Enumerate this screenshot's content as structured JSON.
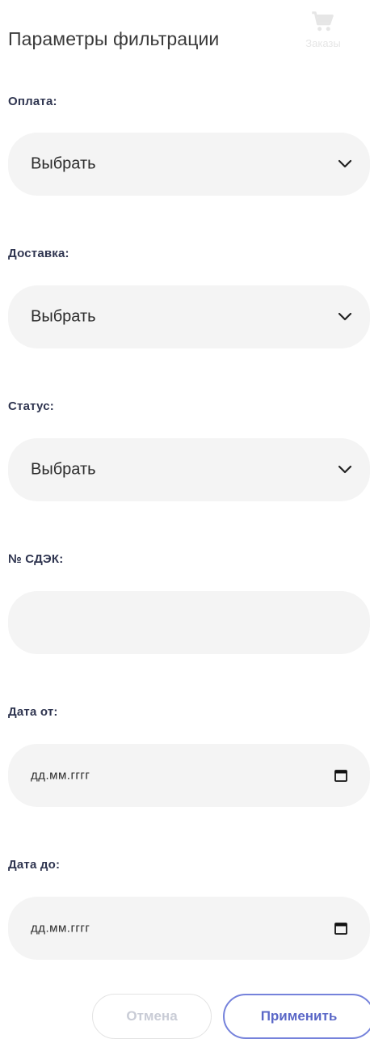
{
  "header": {
    "title": "Параметры фильтрации",
    "cart_label": "Заказы",
    "cart_icon": "shopping-cart-icon"
  },
  "fields": {
    "payment": {
      "label": "Оплата:",
      "value": "Выбрать"
    },
    "delivery": {
      "label": "Доставка:",
      "value": "Выбрать"
    },
    "status": {
      "label": "Статус:",
      "value": "Выбрать"
    },
    "cdek": {
      "label": "№ СДЭК:",
      "value": ""
    },
    "date_from": {
      "label": "Дата от:",
      "placeholder": "дд.мм.гггг"
    },
    "date_to": {
      "label": "Дата до:",
      "placeholder": "дд.мм.гггг"
    }
  },
  "buttons": {
    "cancel": "Отмена",
    "apply": "Применить"
  },
  "colors": {
    "field_bg": "#f4f4f4",
    "accent": "#5a67c7",
    "label": "#2f3550"
  }
}
